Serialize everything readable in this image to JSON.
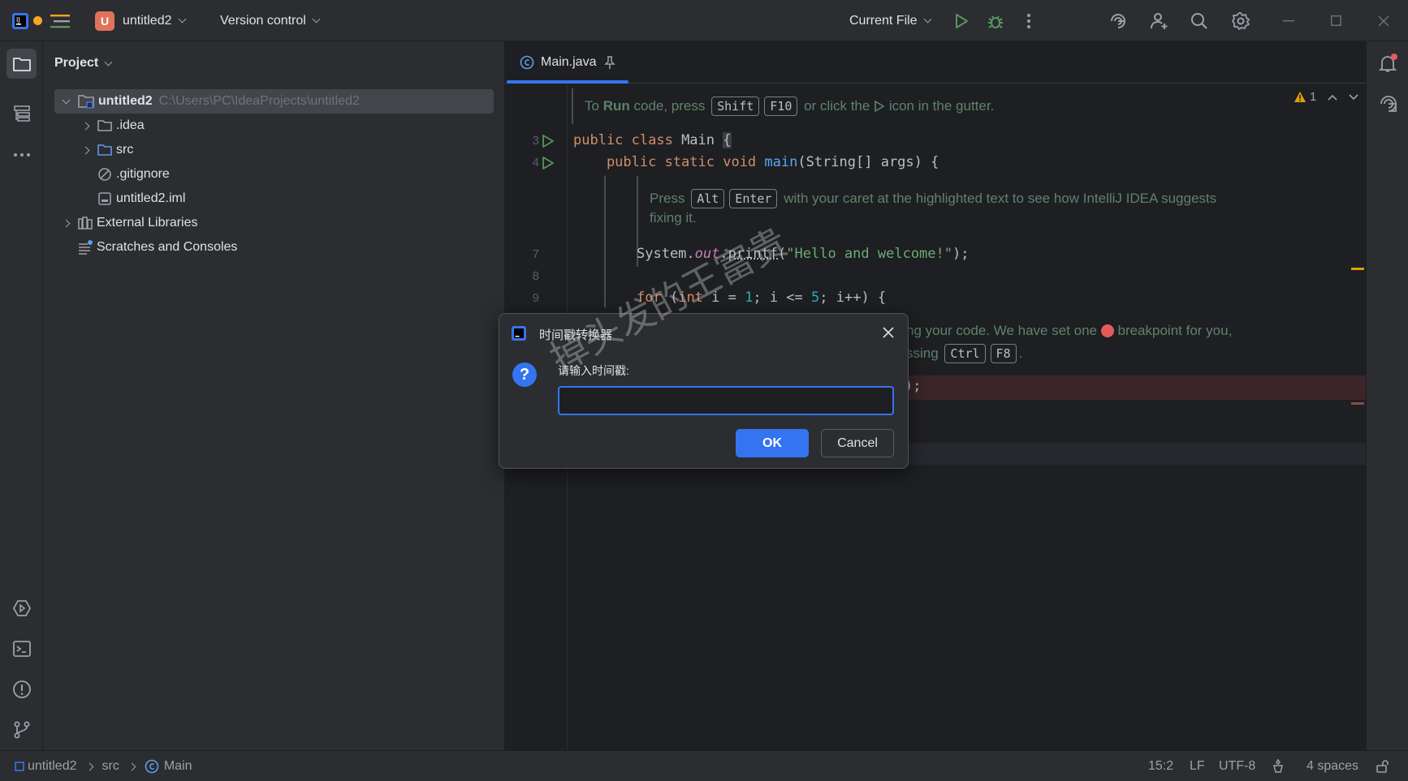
{
  "titlebar": {
    "project_badge": "U",
    "project_name": "untitled2",
    "version_control": "Version control",
    "run_config": "Current File",
    "icons": [
      "intellij-logo-icon",
      "dot-icon",
      "hamburger-menu-icon",
      "run-icon",
      "debug-icon",
      "more-icon",
      "ai-assistant-icon",
      "add-user-icon",
      "search-icon",
      "settings-icon",
      "minimize-icon",
      "maximize-icon",
      "close-icon"
    ]
  },
  "project_panel": {
    "title": "Project",
    "tree": [
      {
        "label": "untitled2",
        "path": "C:\\Users\\PC\\IdeaProjects\\untitled2"
      },
      {
        "label": ".idea"
      },
      {
        "label": "src"
      },
      {
        "label": ".gitignore"
      },
      {
        "label": "untitled2.iml"
      },
      {
        "label": "External Libraries"
      },
      {
        "label": "Scratches and Consoles"
      }
    ]
  },
  "editor": {
    "tab": "Main.java",
    "inspection_count": "1",
    "doc1": {
      "pre": "To",
      "run": "Run",
      "mid": "code, press",
      "k1": "Shift",
      "k2": "F10",
      "post1": "or click the",
      "post2": "icon in the gutter."
    },
    "line_numbers": [
      "3",
      "4",
      "7",
      "8",
      "9"
    ],
    "code": {
      "l3a": "public class ",
      "l3b": "Main ",
      "l3c": "{",
      "l4a": "    public static void ",
      "l4b": "main",
      "l4c": "(String[] args) {",
      "l7a": "System.",
      "l7b": "out",
      "l7c": ".",
      "l7d": "printf",
      "l7e": "(",
      "l7f": "\"Hello and welcome!\"",
      "l7g": ");",
      "l9a": "for ",
      "l9b": "(",
      "l9c": "int ",
      "l9d": "i = ",
      "l9e": "1",
      "l9f": "; i <= ",
      "l9g": "5",
      "l9h": "; i++) {",
      "l12tail": ");"
    },
    "doc2": {
      "pre": "Press",
      "k1": "Alt",
      "k2": "Enter",
      "post": "with your caret at the highlighted text to see how IntelliJ IDEA suggests",
      "line2": "fixing it."
    },
    "doc3": {
      "a": "ng your code. We have set one",
      "b": "breakpoint for you,",
      "c": "ssing",
      "k1": "Ctrl",
      "k2": "F8",
      "d": "."
    }
  },
  "dialog": {
    "title": "时间戳转换器",
    "prompt": "请输入时间戳:",
    "input_value": "",
    "ok": "OK",
    "cancel": "Cancel"
  },
  "watermark": "掉头发的王富贵",
  "statusbar": {
    "crumbs": [
      "untitled2",
      "src",
      "Main"
    ],
    "position": "15:2",
    "line_sep": "LF",
    "encoding": "UTF-8",
    "indent": "4 spaces"
  },
  "colors": {
    "accent": "#3574f0",
    "breakpoint_line": "#3b2528",
    "warning": "#e0a000"
  }
}
